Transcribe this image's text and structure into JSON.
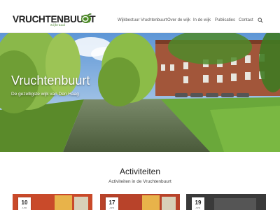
{
  "logo": {
    "name": "VRUCHTENBUURT",
    "sub": "wijkraad"
  },
  "nav": {
    "items": [
      "Wijkbestuur Vruchtenbuurt",
      "Over de wijk",
      "In de wijk",
      "Publicaties",
      "Contact"
    ]
  },
  "hero": {
    "title": "Vruchtenbuurt",
    "subtitle": "De gezelligste wijk van Den Haag"
  },
  "activities": {
    "title": "Activiteiten",
    "subtitle": "Activiteiten in de Vruchtenbuurt",
    "cards": [
      {
        "day": "10",
        "month": "APR"
      },
      {
        "day": "17",
        "month": "APR"
      },
      {
        "day": "19",
        "month": "APR"
      }
    ]
  },
  "colors": {
    "accent": "#3c7a20",
    "card1": "#c94a2a",
    "card2": "#b8432a",
    "card3": "#3a3a3a"
  }
}
